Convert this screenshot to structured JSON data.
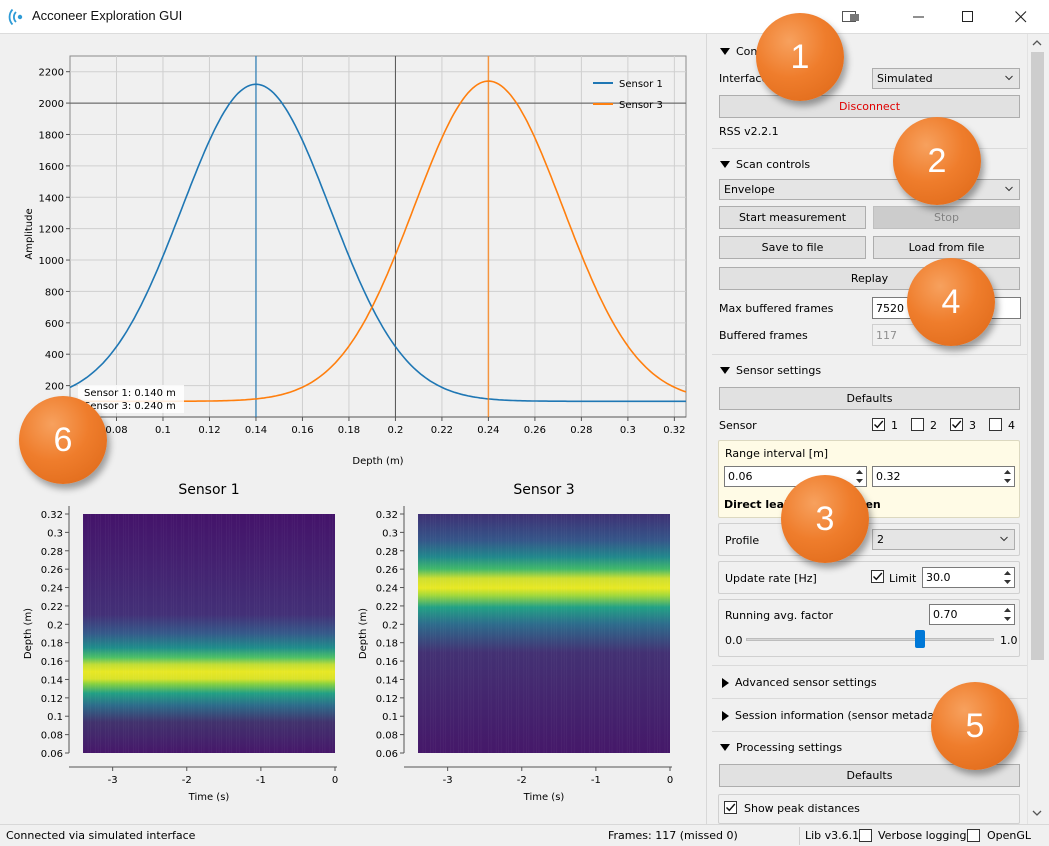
{
  "window": {
    "title": "Acconeer Exploration GUI"
  },
  "sidebar": {
    "connection": {
      "header": "Connection",
      "interface_label": "Interface",
      "interface_value": "Simulated",
      "disconnect_label": "Disconnect",
      "rss_version": "RSS v2.2.1"
    },
    "scan": {
      "header": "Scan controls",
      "mode_value": "Envelope",
      "start_label": "Start measurement",
      "stop_label": "Stop",
      "save_label": "Save to file",
      "load_label": "Load from file",
      "replay_label": "Replay",
      "max_buffered_label": "Max buffered frames",
      "max_buffered_value": "7520",
      "buffered_label": "Buffered frames",
      "buffered_value": "117"
    },
    "sensor_settings": {
      "header": "Sensor settings",
      "defaults_label": "Defaults",
      "sensor_label": "Sensor",
      "sensors": [
        {
          "label": "1",
          "checked": true
        },
        {
          "label": "2",
          "checked": false
        },
        {
          "label": "3",
          "checked": true
        },
        {
          "label": "4",
          "checked": false
        }
      ],
      "range_label": "Range interval [m]",
      "range_start": "0.06",
      "range_end": "0.32",
      "direct_leakage_label": "Direct leak",
      "direct_leakage_suffix": "een",
      "profile_label": "Profile",
      "profile_value": "2",
      "update_rate_label": "Update rate [Hz]",
      "limit_label": "Limit",
      "limit_checked": true,
      "update_rate_value": "30.0",
      "running_avg_label": "Running avg. factor",
      "running_avg_value": "0.70",
      "slider_min": "0.0",
      "slider_max": "1.0",
      "slider_fraction": 0.7
    },
    "advanced_header": "Advanced sensor settings",
    "session_header": "Session information (sensor metadata)",
    "processing": {
      "header": "Processing settings",
      "defaults_label": "Defaults",
      "show_peak_label": "Show peak distances",
      "show_peak_checked": true
    }
  },
  "status": {
    "message": "Connected via simulated interface",
    "frames": "Frames: 117 (missed 0)",
    "lib": "Lib v3.6.1",
    "verbose_label": "Verbose logging",
    "opengl_label": "OpenGL"
  },
  "badges": [
    "1",
    "2",
    "3",
    "4",
    "5",
    "6"
  ],
  "colors": {
    "sensor1": "#1f77b4",
    "sensor3": "#ff7f0e",
    "disconnect": "#e00000",
    "badge": "#ef7d2c"
  },
  "chart_data": [
    {
      "type": "line",
      "xlabel": "Depth (m)",
      "ylabel": "Amplitude",
      "xlim": [
        0.06,
        0.325
      ],
      "ylim": [
        0,
        2300
      ],
      "xticks": [
        "0.08",
        "0.1",
        "0.12",
        "0.14",
        "0.16",
        "0.18",
        "0.2",
        "0.22",
        "0.24",
        "0.26",
        "0.28",
        "0.3",
        "0.32"
      ],
      "yticks": [
        "200",
        "400",
        "600",
        "800",
        "1000",
        "1200",
        "1400",
        "1600",
        "1800",
        "2000",
        "2200"
      ],
      "legend": "top-right",
      "series": [
        {
          "name": "Sensor 1",
          "color": "#1f77b4",
          "peak_x": 0.14,
          "peak_y": 2120,
          "baseline": 100,
          "sigma": 0.032,
          "x": [
            0.06,
            0.08,
            0.1,
            0.12,
            0.13,
            0.14,
            0.15,
            0.16,
            0.18,
            0.2,
            0.22,
            0.24,
            0.26,
            0.3,
            0.32
          ],
          "y": [
            230,
            500,
            1050,
            1780,
            2040,
            2120,
            2040,
            1780,
            1050,
            500,
            230,
            130,
            105,
            100,
            100
          ]
        },
        {
          "name": "Sensor 3",
          "color": "#ff7f0e",
          "peak_x": 0.24,
          "peak_y": 2140,
          "baseline": 100,
          "sigma": 0.032,
          "x": [
            0.06,
            0.1,
            0.14,
            0.16,
            0.18,
            0.2,
            0.22,
            0.23,
            0.24,
            0.25,
            0.26,
            0.28,
            0.3,
            0.32
          ],
          "y": [
            100,
            100,
            130,
            230,
            500,
            1050,
            1780,
            2040,
            2140,
            2040,
            1780,
            1050,
            500,
            230
          ]
        }
      ],
      "peak_annotations": [
        "Sensor 1: 0.140 m",
        "Sensor 3: 0.240 m"
      ]
    },
    {
      "type": "heatmap",
      "title": "Sensor 1",
      "xlabel": "Time (s)",
      "ylabel": "Depth (m)",
      "xticks": [
        "-3",
        "-2",
        "-1",
        "0"
      ],
      "yticks": [
        "0.06",
        "0.08",
        "0.1",
        "0.12",
        "0.14",
        "0.16",
        "0.18",
        "0.2",
        "0.22",
        "0.24",
        "0.26",
        "0.28",
        "0.3",
        "0.32"
      ],
      "peak_depth": 0.14
    },
    {
      "type": "heatmap",
      "title": "Sensor 3",
      "xlabel": "Time (s)",
      "ylabel": "Depth (m)",
      "xticks": [
        "-3",
        "-2",
        "-1",
        "0"
      ],
      "yticks": [
        "0.06",
        "0.08",
        "0.1",
        "0.12",
        "0.14",
        "0.16",
        "0.18",
        "0.2",
        "0.22",
        "0.24",
        "0.26",
        "0.28",
        "0.3",
        "0.32"
      ],
      "peak_depth": 0.24
    }
  ]
}
